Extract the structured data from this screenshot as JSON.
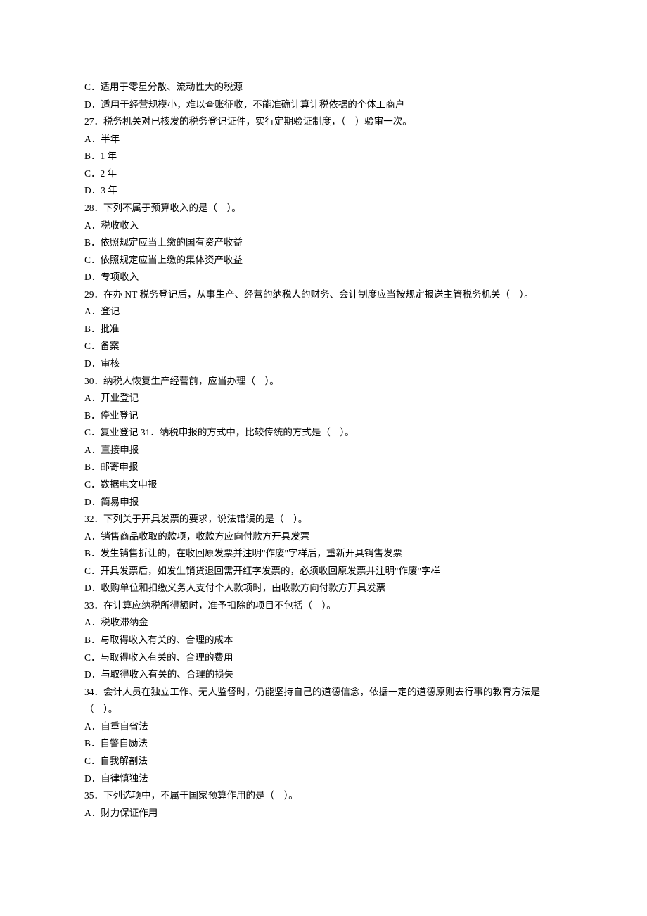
{
  "lines": [
    "C．适用于零星分散、流动性大的税源",
    "D．适用于经营规模小，难以查账征收，不能准确计算计税依据的个体工商户",
    "27．税务机关对已核发的税务登记证件，实行定期验证制度，（　）验审一次。",
    "A．半年",
    "B．1 年",
    "C．2 年",
    "D．3 年",
    "28．下列不属于预算收入的是（　）。",
    "A．税收收入",
    "B．依照规定应当上缴的国有资产收益",
    "C．依照规定应当上缴的集体资产收益",
    "D．专项收入",
    "29．在办 NT 税务登记后，从事生产、经营的纳税人的财务、会计制度应当按规定报送主管税务机关（　）。",
    "A．登记",
    "B．批准",
    "C．备案",
    "D．审核",
    "30．纳税人恢复生产经营前，应当办理（　）。",
    "A．开业登记",
    "B．停业登记",
    "C．复业登记 31．纳税申报的方式中，比较传统的方式是（　）。",
    "A．直接申报",
    "B．邮寄申报",
    "C．数据电文申报",
    "D．简易申报",
    "32．下列关于开具发票的要求，说法错误的是（　）。",
    "A．销售商品收取的款项，收款方应向付款方开具发票",
    "B．发生销售折让的，在收回原发票并注明\"作废\"字样后，重新开具销售发票",
    "C．开具发票后，如发生销货退回需开红字发票的，必须收回原发票并注明\"作废\"字样",
    "D．收购单位和扣缴义务人支付个人款项时，由收款方向付款方开具发票",
    "33．在计算应纳税所得额时，准予扣除的项目不包括（　）。",
    "A．税收滞纳金",
    "B．与取得收入有关的、合理的成本",
    "C．与取得收入有关的、合理的费用",
    "D．与取得收入有关的、合理的损失",
    "34．会计人员在独立工作、无人监督时，仍能坚持自己的道德信念，依据一定的道德原则去行事的教育方法是（　）。",
    "A．自重自省法",
    "B．自警自励法",
    "C．自我解剖法",
    "D．自律慎独法",
    "35．下列选项中，不属于国家预算作用的是（　）。",
    "A．财力保证作用"
  ]
}
